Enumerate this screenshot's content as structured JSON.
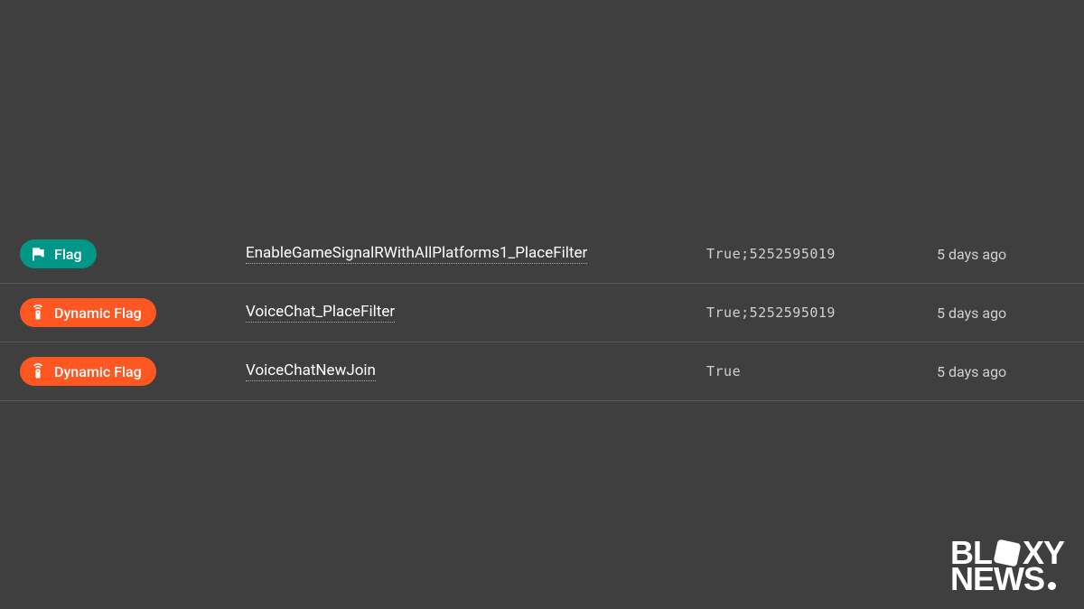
{
  "badges": {
    "flag_label": "Flag",
    "dynamic_flag_label": "Dynamic Flag"
  },
  "rows": [
    {
      "type": "flag",
      "name": "EnableGameSignalRWithAllPlatforms1_PlaceFilter",
      "value": "True;5252595019",
      "time": "5 days ago"
    },
    {
      "type": "dynamic",
      "name": "VoiceChat_PlaceFilter",
      "value": "True;5252595019",
      "time": "5 days ago"
    },
    {
      "type": "dynamic",
      "name": "VoiceChatNewJoin",
      "value": "True",
      "time": "5 days ago"
    }
  ],
  "watermark": {
    "line1_left": "BL",
    "line1_right": "XY",
    "line2": "NEWS"
  },
  "colors": {
    "teal": "#009688",
    "orange": "#ff5722",
    "bg": "#3f3f3f"
  }
}
